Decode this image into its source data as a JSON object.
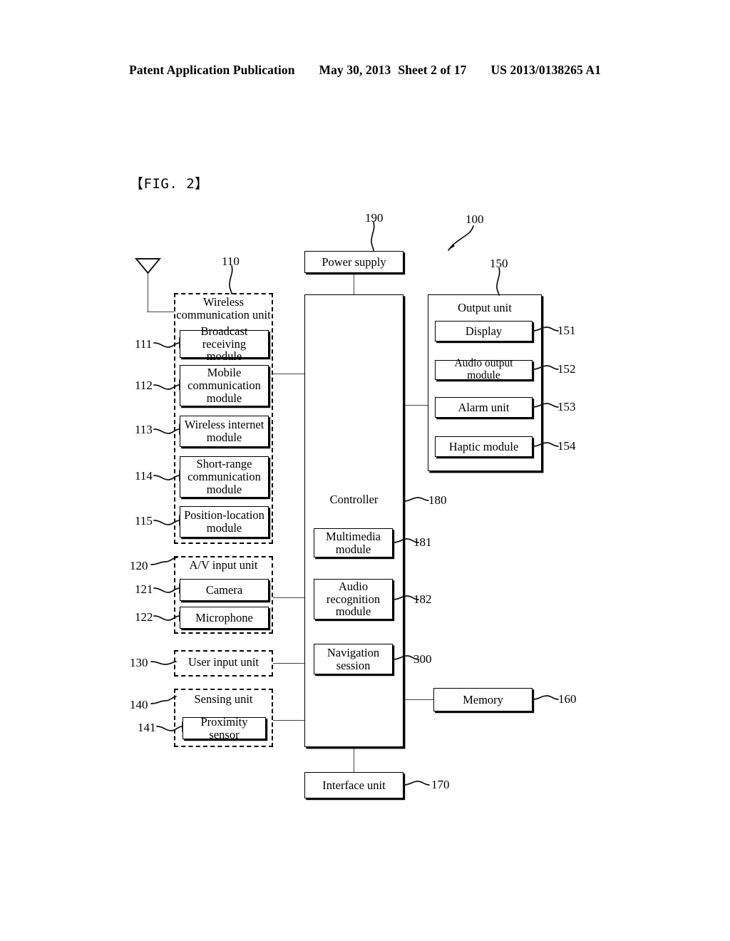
{
  "header": {
    "publication": "Patent Application Publication",
    "date": "May 30, 2013",
    "sheet": "Sheet 2 of 17",
    "patent_number": "US 2013/0138265 A1"
  },
  "figure": {
    "label": "【FIG. 2】",
    "device_ref": "100"
  },
  "blocks": {
    "power_supply": {
      "label": "Power supply",
      "ref": "190"
    },
    "controller": {
      "label": "Controller",
      "ref": "180"
    },
    "multimedia_module": {
      "label": "Multimedia\nmodule",
      "ref": "181"
    },
    "audio_recognition_module": {
      "label": "Audio\nrecognition\nmodule",
      "ref": "182"
    },
    "navigation_session": {
      "label": "Navigation\nsession",
      "ref": "300"
    },
    "interface_unit": {
      "label": "Interface unit",
      "ref": "170"
    },
    "memory": {
      "label": "Memory",
      "ref": "160"
    },
    "wireless_communication_unit": {
      "label": "Wireless\ncommunication unit",
      "ref": "110"
    },
    "broadcast_receiving_module": {
      "label": "Broadcast receiving\nmodule",
      "ref": "111"
    },
    "mobile_communication_module": {
      "label": "Mobile\ncommunication\nmodule",
      "ref": "112"
    },
    "wireless_internet_module": {
      "label": "Wireless internet\nmodule",
      "ref": "113"
    },
    "short_range_communication_module": {
      "label": "Short-range\ncommunication\nmodule",
      "ref": "114"
    },
    "position_location_module": {
      "label": "Position-location\nmodule",
      "ref": "115"
    },
    "av_input_unit": {
      "label": "A/V input unit",
      "ref": "120"
    },
    "camera": {
      "label": "Camera",
      "ref": "121"
    },
    "microphone": {
      "label": "Microphone",
      "ref": "122"
    },
    "user_input_unit": {
      "label": "User input unit",
      "ref": "130"
    },
    "sensing_unit": {
      "label": "Sensing unit",
      "ref": "140"
    },
    "proximity_sensor": {
      "label": "Proximity sensor",
      "ref": "141"
    },
    "output_unit": {
      "label": "Output unit",
      "ref": "150"
    },
    "display": {
      "label": "Display",
      "ref": "151"
    },
    "audio_output_module": {
      "label": "Audio output module",
      "ref": "152"
    },
    "alarm_unit": {
      "label": "Alarm unit",
      "ref": "153"
    },
    "haptic_module": {
      "label": "Haptic module",
      "ref": "154"
    }
  },
  "icons": {
    "antenna": "antenna-icon"
  },
  "colors": {
    "ink": "#000000",
    "paper": "#ffffff",
    "line": "#444444"
  }
}
